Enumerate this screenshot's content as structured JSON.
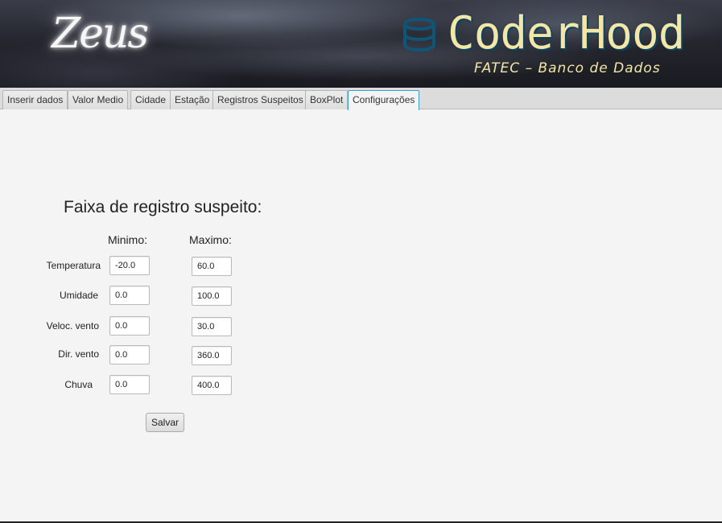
{
  "banner": {
    "app_name": "Zeus",
    "brand": "CoderHood",
    "subtitle": "FATEC – Banco de Dados",
    "logo_icon": "database-icon",
    "brand_color": "#f3e6a6"
  },
  "tabs": [
    {
      "label": "Inserir dados"
    },
    {
      "label": "Valor Medio"
    },
    {
      "label": "Cidade"
    },
    {
      "label": "Estação"
    },
    {
      "label": "Registros Suspeitos"
    },
    {
      "label": "BoxPlot"
    },
    {
      "label": "Configurações",
      "active": true
    }
  ],
  "form": {
    "title": "Faixa de registro suspeito:",
    "col_min": "Minimo:",
    "col_max": "Maximo:",
    "rows": [
      {
        "label": "Temperatura",
        "min": "-20.0",
        "max": "60.0"
      },
      {
        "label": "Umidade",
        "min": "0.0",
        "max": "100.0"
      },
      {
        "label": "Veloc. vento",
        "min": "0.0",
        "max": "30.0"
      },
      {
        "label": "Dir. vento",
        "min": "0.0",
        "max": "360.0"
      },
      {
        "label": "Chuva",
        "min": "0.0",
        "max": "400.0"
      }
    ],
    "save_label": "Salvar"
  },
  "colors": {
    "accent": "#3c9bd0"
  }
}
